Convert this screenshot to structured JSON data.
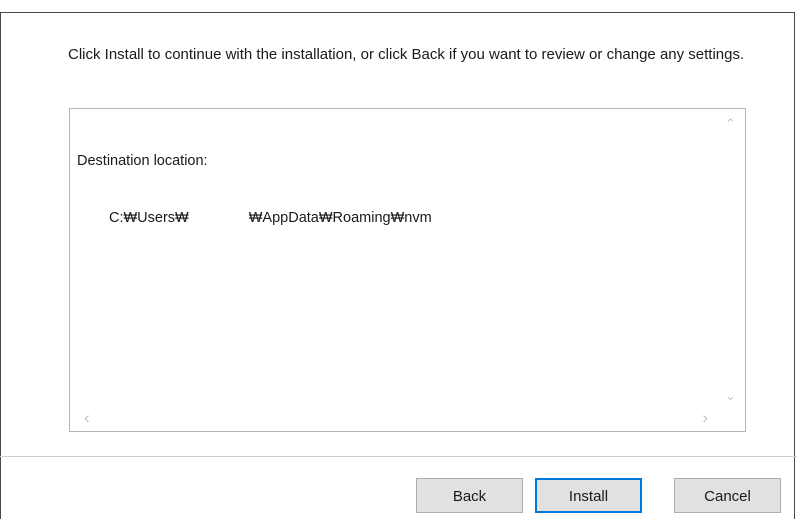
{
  "dialog": {
    "instruction": "Click Install to continue with the installation, or click Back if you want to review or change any settings."
  },
  "memo": {
    "heading": "Destination location:",
    "path_prefix": "C:₩Users₩",
    "path_suffix": "₩AppData₩Roaming₩nvm"
  },
  "scrollbar": {
    "up_arrow": "⌃",
    "down_arrow": "⌄",
    "left_arrow": "‹",
    "right_arrow": "›"
  },
  "buttons": {
    "back": "Back",
    "install": "Install",
    "cancel": "Cancel"
  }
}
